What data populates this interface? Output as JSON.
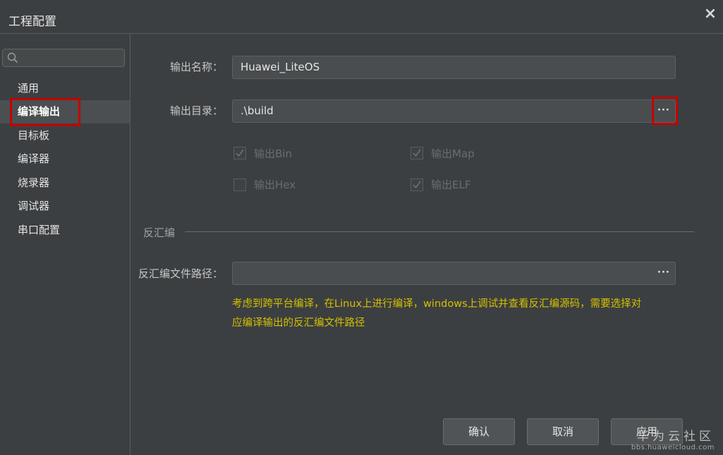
{
  "window": {
    "title": "工程配置",
    "close_label": "×"
  },
  "sidebar": {
    "items": [
      {
        "label": "通用"
      },
      {
        "label": "编译输出",
        "active": true
      },
      {
        "label": "目标板"
      },
      {
        "label": "编译器"
      },
      {
        "label": "烧录器"
      },
      {
        "label": "调试器"
      },
      {
        "label": "串口配置"
      }
    ]
  },
  "output": {
    "name_label": "输出名称：",
    "name_value": "Huawei_LiteOS",
    "dir_label": "输出目录：",
    "dir_value": ".\\build",
    "browse_label": "···",
    "options": [
      {
        "label": "输出Bin",
        "checked": true
      },
      {
        "label": "输出Map",
        "checked": true
      },
      {
        "label": "输出Hex",
        "checked": false
      },
      {
        "label": "输出ELF",
        "checked": true
      }
    ]
  },
  "disassembly": {
    "section_title": "反汇编",
    "path_label": "反汇编文件路径：",
    "path_value": "",
    "browse_label": "···",
    "hint_line1": "考虑到跨平台编译，在Linux上进行编译，windows上调试并查看反汇编源码，需要选择对",
    "hint_line2": "应编译输出的反汇编文件路径"
  },
  "buttons": {
    "ok": "确认",
    "cancel": "取消",
    "apply": "应用"
  },
  "watermark": {
    "main": "华为云社区",
    "sub": "bbs.huaweicloud.com"
  },
  "colors": {
    "highlight_box": "#c40000",
    "hint_text": "#d4c000"
  }
}
